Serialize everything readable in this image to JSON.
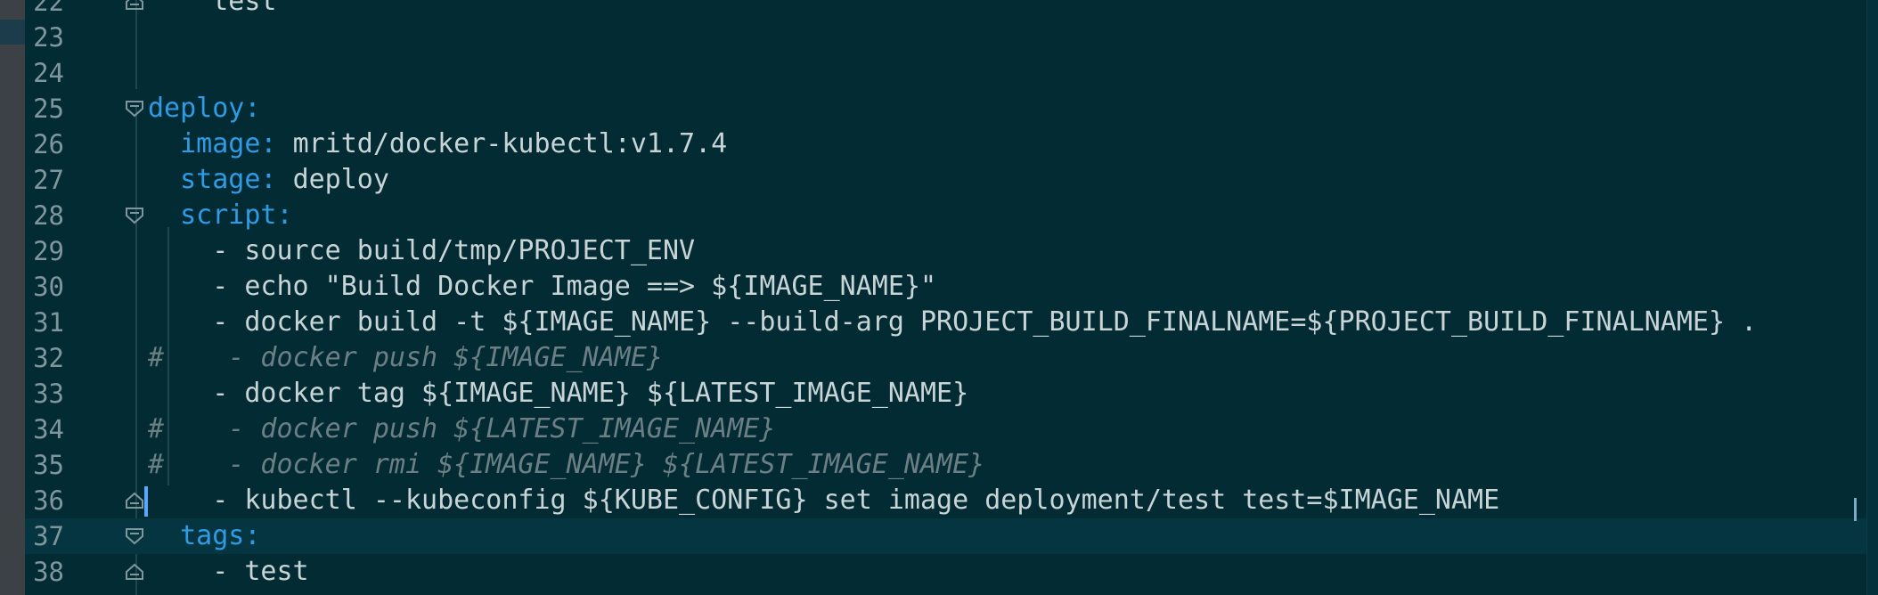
{
  "editor": {
    "lines": [
      {
        "num": "22",
        "indent": "    ",
        "key": "",
        "sep": "",
        "value": "test",
        "comment": "",
        "fold": "end"
      },
      {
        "num": "23",
        "indent": "",
        "key": "",
        "sep": "",
        "value": "",
        "comment": "",
        "fold": ""
      },
      {
        "num": "24",
        "indent": "",
        "key": "",
        "sep": "",
        "value": "",
        "comment": "",
        "fold": ""
      },
      {
        "num": "25",
        "indent": "",
        "key": "deploy",
        "sep": ":",
        "value": "",
        "comment": "",
        "fold": "start"
      },
      {
        "num": "26",
        "indent": "  ",
        "key": "image",
        "sep": ": ",
        "value": "mritd/docker-kubectl:v1.7.4",
        "comment": "",
        "fold": ""
      },
      {
        "num": "27",
        "indent": "  ",
        "key": "stage",
        "sep": ": ",
        "value": "deploy",
        "comment": "",
        "fold": ""
      },
      {
        "num": "28",
        "indent": "  ",
        "key": "script",
        "sep": ":",
        "value": "",
        "comment": "",
        "fold": "start"
      },
      {
        "num": "29",
        "indent": "    ",
        "key": "",
        "sep": "",
        "value": "- source build/tmp/PROJECT_ENV",
        "comment": "",
        "fold": ""
      },
      {
        "num": "30",
        "indent": "    ",
        "key": "",
        "sep": "",
        "value": "- echo \"Build Docker Image ==> ${IMAGE_NAME}\"",
        "comment": "",
        "fold": ""
      },
      {
        "num": "31",
        "indent": "    ",
        "key": "",
        "sep": "",
        "value": "- docker build -t ${IMAGE_NAME} --build-arg PROJECT_BUILD_FINALNAME=${PROJECT_BUILD_FINALNAME} .",
        "comment": "",
        "fold": ""
      },
      {
        "num": "32",
        "indent": "",
        "key": "",
        "sep": "",
        "value": "",
        "comment": "#    - docker push ${IMAGE_NAME}",
        "fold": ""
      },
      {
        "num": "33",
        "indent": "    ",
        "key": "",
        "sep": "",
        "value": "- docker tag ${IMAGE_NAME} ${LATEST_IMAGE_NAME}",
        "comment": "",
        "fold": ""
      },
      {
        "num": "34",
        "indent": "",
        "key": "",
        "sep": "",
        "value": "",
        "comment": "#    - docker push ${LATEST_IMAGE_NAME}",
        "fold": ""
      },
      {
        "num": "35",
        "indent": "",
        "key": "",
        "sep": "",
        "value": "",
        "comment": "#    - docker rmi ${IMAGE_NAME} ${LATEST_IMAGE_NAME}",
        "fold": ""
      },
      {
        "num": "36",
        "indent": "    ",
        "key": "",
        "sep": "",
        "value": "- kubectl --kubeconfig ${KUBE_CONFIG} set image deployment/test test=$IMAGE_NAME",
        "comment": "",
        "fold": "end"
      },
      {
        "num": "37",
        "indent": "  ",
        "key": "tags",
        "sep": ":",
        "value": "",
        "comment": "",
        "fold": "start",
        "current": true
      },
      {
        "num": "38",
        "indent": "    ",
        "key": "",
        "sep": "",
        "value": "- test",
        "comment": "",
        "fold": "end"
      }
    ]
  }
}
